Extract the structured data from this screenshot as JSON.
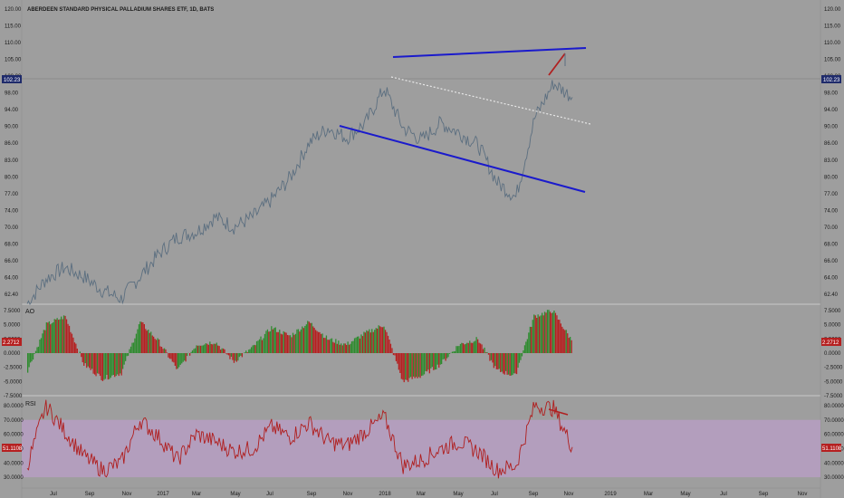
{
  "window": {
    "title": "ABERDEEN STANDARD PHYSICAL PALLADIUM SHARES ETF, 1D, BATS"
  },
  "colors": {
    "background": "#9e9e9e",
    "price_line": "#5c6f80",
    "trend_blue": "#1a1acc",
    "trend_dotted": "#e8e8e8",
    "trend_red": "#b02020",
    "ao_up": "#2e8b2e",
    "ao_down": "#b52020",
    "rsi_line": "#b01e1e",
    "rsi_band": "#b89ec4",
    "price_tag": "#1f2b6b",
    "ao_tag": "#b52020",
    "rsi_tag": "#b52020"
  },
  "price_pane": {
    "y_ticks": [
      "120.00",
      "115.00",
      "110.00",
      "105.00",
      "100.00",
      "98.00",
      "94.00",
      "90.00",
      "86.00",
      "83.00",
      "80.00",
      "77.00",
      "74.00",
      "70.00",
      "68.00",
      "66.00",
      "64.00",
      "62.40"
    ],
    "last_price_label": "102.23"
  },
  "ao_pane": {
    "label": "AO",
    "y_ticks": [
      "7.5000",
      "5.0000",
      "2.5000",
      "0.0000",
      "-2.5000",
      "-5.0000",
      "-7.5000"
    ],
    "last_value_label": "2.2712"
  },
  "rsi_pane": {
    "label": "RSI",
    "y_ticks": [
      "80.0000",
      "70.0000",
      "60.0000",
      "50.0000",
      "40.0000",
      "30.0000"
    ],
    "last_value_label": "51.1108"
  },
  "x_axis": {
    "labels": [
      "Jul",
      "Sep",
      "Nov",
      "2017",
      "Mar",
      "May",
      "Jul",
      "Sep",
      "Nov",
      "2018",
      "Mar",
      "May",
      "Jul",
      "Sep",
      "Nov",
      "2019",
      "Mar",
      "May",
      "Jul",
      "Sep",
      "Nov"
    ]
  },
  "chart_data": [
    {
      "type": "line",
      "title": "ABERDEEN STANDARD PHYSICAL PALLADIUM SHARES ETF, 1D, BATS",
      "x": [
        "2016-06",
        "2016-07",
        "2016-08",
        "2016-09",
        "2016-10",
        "2016-11",
        "2016-12",
        "2017-01",
        "2017-02",
        "2017-03",
        "2017-04",
        "2017-05",
        "2017-06",
        "2017-07",
        "2017-08",
        "2017-09",
        "2017-10",
        "2017-11",
        "2017-12",
        "2018-01",
        "2018-02",
        "2018-03",
        "2018-04",
        "2018-05",
        "2018-06",
        "2018-07",
        "2018-08",
        "2018-09",
        "2018-10",
        "2018-11"
      ],
      "series": [
        {
          "values": [
            60.5,
            65.5,
            67.8,
            66.0,
            63.2,
            61.5,
            66.0,
            70.5,
            74.0,
            75.0,
            78.0,
            76.0,
            78.0,
            81.5,
            86.0,
            93.0,
            96.0,
            94.0,
            97.0,
            104.0,
            96.0,
            93.5,
            97.0,
            95.0,
            92.5,
            85.0,
            82.0,
            98.0,
            105.0,
            102.2
          ]
        }
      ],
      "ylim": [
        62.4,
        120.0
      ],
      "grid": false
    },
    {
      "type": "bar",
      "title": "AO",
      "x": [
        "2016-06",
        "2016-07",
        "2016-08",
        "2016-09",
        "2016-10",
        "2016-11",
        "2016-12",
        "2017-01",
        "2017-02",
        "2017-03",
        "2017-04",
        "2017-05",
        "2017-06",
        "2017-07",
        "2017-08",
        "2017-09",
        "2017-10",
        "2017-11",
        "2017-12",
        "2018-01",
        "2018-02",
        "2018-03",
        "2018-04",
        "2018-05",
        "2018-06",
        "2018-07",
        "2018-08",
        "2018-09",
        "2018-10",
        "2018-11"
      ],
      "series": [
        {
          "values": [
            -3.0,
            5.0,
            6.5,
            -2.0,
            -4.5,
            -3.5,
            5.5,
            2.0,
            -3.0,
            1.5,
            2.0,
            -1.5,
            1.0,
            4.5,
            3.0,
            5.5,
            2.5,
            1.5,
            3.5,
            5.0,
            -5.0,
            -4.0,
            -2.0,
            1.5,
            2.5,
            -3.0,
            -4.0,
            6.5,
            7.5,
            2.27
          ]
        }
      ],
      "ylim": [
        -7.5,
        7.5
      ],
      "grid": false
    },
    {
      "type": "line",
      "title": "RSI",
      "x": [
        "2016-06",
        "2016-07",
        "2016-08",
        "2016-09",
        "2016-10",
        "2016-11",
        "2016-12",
        "2017-01",
        "2017-02",
        "2017-03",
        "2017-04",
        "2017-05",
        "2017-06",
        "2017-07",
        "2017-08",
        "2017-09",
        "2017-10",
        "2017-11",
        "2017-12",
        "2018-01",
        "2018-02",
        "2018-03",
        "2018-04",
        "2018-05",
        "2018-06",
        "2018-07",
        "2018-08",
        "2018-09",
        "2018-10",
        "2018-11"
      ],
      "series": [
        {
          "values": [
            38,
            80,
            62,
            45,
            35,
            40,
            70,
            58,
            42,
            60,
            55,
            48,
            50,
            65,
            58,
            68,
            55,
            52,
            62,
            72,
            38,
            42,
            50,
            55,
            48,
            35,
            38,
            80,
            78,
            51.11
          ]
        }
      ],
      "ylim": [
        25,
        85
      ],
      "grid": false
    }
  ]
}
